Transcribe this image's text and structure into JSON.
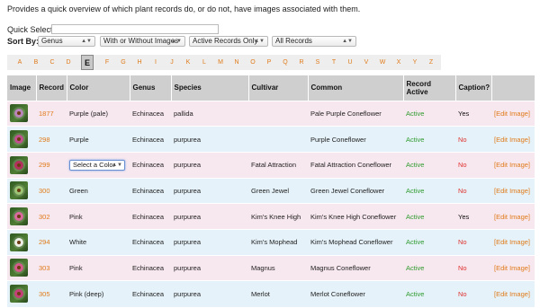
{
  "intro": "Provides a quick overview of which plant records do, or do not, have images associated with them.",
  "quick_select": {
    "label": "Quick Select:",
    "value": ""
  },
  "sort": {
    "label": "Sort By:",
    "genus": "Genus",
    "images": "With or Without Images",
    "active": "Active Records Only",
    "records": "All Records"
  },
  "letters": [
    "A",
    "B",
    "C",
    "D",
    "E",
    "F",
    "G",
    "H",
    "I",
    "J",
    "K",
    "L",
    "M",
    "N",
    "O",
    "P",
    "Q",
    "R",
    "S",
    "T",
    "U",
    "V",
    "W",
    "X",
    "Y",
    "Z"
  ],
  "current_letter": "E",
  "columns": [
    "Image",
    "Record",
    "Color",
    "Genus",
    "Species",
    "Cultivar",
    "Common",
    "Record Active",
    "Caption?",
    ""
  ],
  "rows": [
    {
      "record": "1877",
      "color": "Purple (pale)",
      "genus": "Echinacea",
      "species": "pallida",
      "cultivar": "",
      "common": "Pale Purple Coneflower",
      "active": "Active",
      "caption": "Yes",
      "edit": "[Edit Image]",
      "thumb": "#b885b8"
    },
    {
      "record": "298",
      "color": "Purple",
      "genus": "Echinacea",
      "species": "purpurea",
      "cultivar": "",
      "common": "Purple Coneflower",
      "active": "Active",
      "caption": "No",
      "edit": "[Edit Image]",
      "thumb": "#c0508e"
    },
    {
      "record": "299",
      "color": "Select a Color",
      "genus": "Echinacea",
      "species": "purpurea",
      "cultivar": "Fatal Attraction",
      "common": "Fatal Attraction Coneflower",
      "active": "Active",
      "caption": "No",
      "edit": "[Edit Image]",
      "thumb": "#b3305e"
    },
    {
      "record": "300",
      "color": "Green",
      "genus": "Echinacea",
      "species": "purpurea",
      "cultivar": "Green Jewel",
      "common": "Green Jewel Coneflower",
      "active": "Active",
      "caption": "No",
      "edit": "[Edit Image]",
      "thumb": "#9ec476"
    },
    {
      "record": "302",
      "color": "Pink",
      "genus": "Echinacea",
      "species": "purpurea",
      "cultivar": "Kim's Knee High",
      "common": "Kim's Knee High Coneflower",
      "active": "Active",
      "caption": "Yes",
      "edit": "[Edit Image]",
      "thumb": "#d86a9e"
    },
    {
      "record": "294",
      "color": "White",
      "genus": "Echinacea",
      "species": "purpurea",
      "cultivar": "Kim's Mophead",
      "common": "Kim's Mophead Coneflower",
      "active": "Active",
      "caption": "No",
      "edit": "[Edit Image]",
      "thumb": "#ecefe6"
    },
    {
      "record": "303",
      "color": "Pink",
      "genus": "Echinacea",
      "species": "purpurea",
      "cultivar": "Magnus",
      "common": "Magnus Coneflower",
      "active": "Active",
      "caption": "No",
      "edit": "[Edit Image]",
      "thumb": "#d45a8a"
    },
    {
      "record": "305",
      "color": "Pink (deep)",
      "genus": "Echinacea",
      "species": "purpurea",
      "cultivar": "Merlot",
      "common": "Merlot Coneflower",
      "active": "Active",
      "caption": "No",
      "edit": "[Edit Image]",
      "thumb": "#c33f78"
    }
  ],
  "colors": {
    "accent": "#e07b1a",
    "active": "#2f9b2f",
    "no": "#e0322f",
    "row_pink": "#f7e7ee",
    "row_blue": "#e5f2f9",
    "header": "#cfcfcf"
  }
}
